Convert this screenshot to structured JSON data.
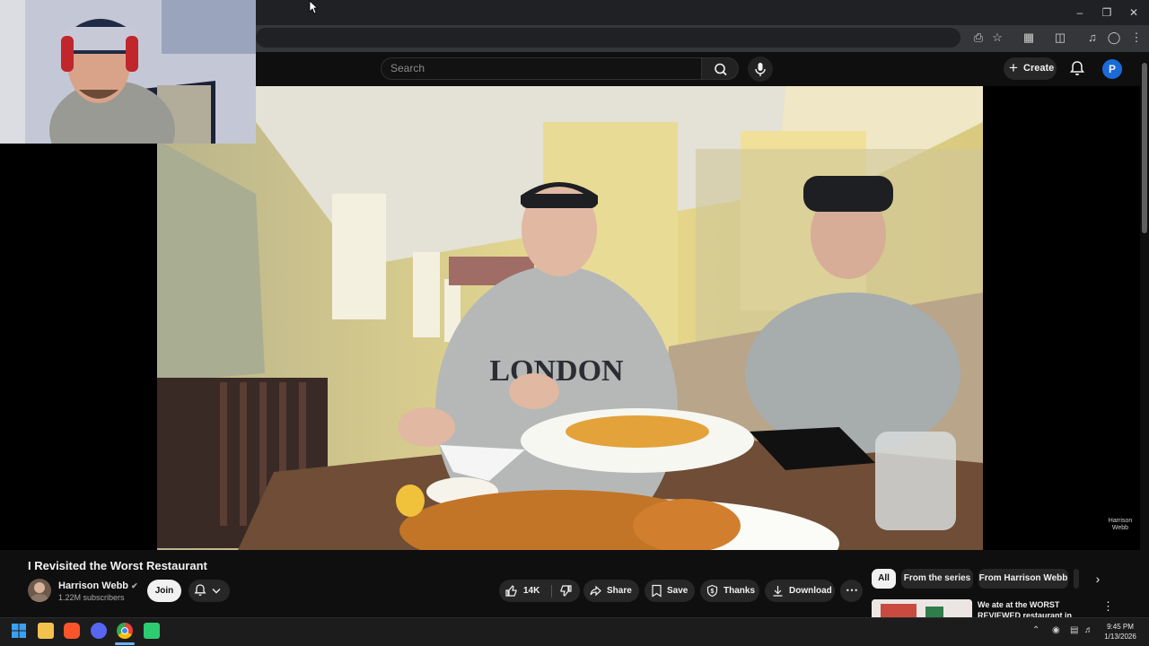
{
  "youtube": {
    "search": {
      "placeholder": "Search"
    },
    "header": {
      "create_label": "Create",
      "avatar_letter": "P"
    }
  },
  "video": {
    "title": "I Revisited the Worst Restaurant",
    "watermark_line1": "Harrison",
    "watermark_line2": "Webb"
  },
  "channel": {
    "name": "Harrison Webb",
    "subscribers": "1.22M subscribers",
    "join_label": "Join"
  },
  "actions": {
    "likes": "14K",
    "share": "Share",
    "save": "Save",
    "thanks": "Thanks",
    "download": "Download"
  },
  "chips": [
    "All",
    "From the series",
    "From Harrison Webb"
  ],
  "related": {
    "title": "We ate at the WORST REVIEWED restaurant in London"
  },
  "taskbar": {
    "time": "9:45 PM",
    "date": "1/13/2026"
  },
  "colors": {
    "youtube_bg": "#0f0f0f",
    "accent_blue": "#1a6bd8",
    "chrome_dark": "#202124"
  }
}
